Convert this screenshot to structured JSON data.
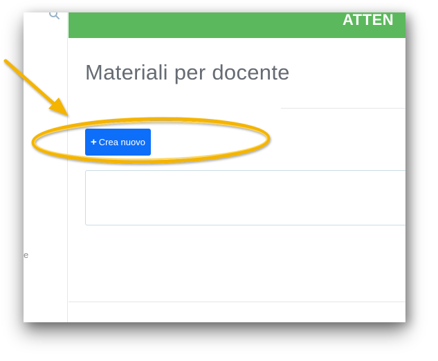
{
  "sidebar": {
    "search_icon": "search-icon",
    "trailing_text": "e"
  },
  "banner": {
    "text": "ATTEN",
    "color": "#5cb85c"
  },
  "main": {
    "title": "Materiali per docente",
    "create_button": {
      "icon": "plus-icon",
      "icon_glyph": "+",
      "label": "Crea nuovo",
      "color": "#0d6ef9"
    }
  },
  "annotation": {
    "arrow_color": "#f4b400",
    "ellipse_color": "#f4b400"
  }
}
